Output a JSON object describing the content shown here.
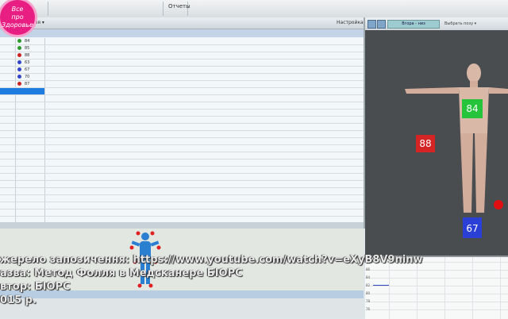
{
  "toolbar": {
    "tab_label": "Отчеты"
  },
  "left_panel": {
    "column_header": "ория ▾",
    "settings_label": "Настройка"
  },
  "rows": [
    {
      "value": "84",
      "color": "#2e9a2e"
    },
    {
      "value": "85",
      "color": "#2e9a2e"
    },
    {
      "value": "88",
      "color": "#cc2222"
    },
    {
      "value": "63",
      "color": "#3344cc"
    },
    {
      "value": "67",
      "color": "#3344cc"
    },
    {
      "value": "70",
      "color": "#3344cc"
    },
    {
      "value": "87",
      "color": "#cc2222"
    }
  ],
  "right_panel": {
    "view_button": "Вгора - низ",
    "select_label": "Выбрать позу ▾",
    "markers": [
      {
        "value": "84",
        "color": "#25c43a"
      },
      {
        "value": "88",
        "color": "#d42424"
      },
      {
        "value": "67",
        "color": "#2a3fd6"
      }
    ]
  },
  "graph_labels": [
    "88",
    "86",
    "84",
    "82",
    "80",
    "78",
    "76"
  ],
  "caption": {
    "line1": "жерело запозичення: https://www.youtube.com/watch?v=eXyB8V9ninw",
    "line2": "азва: Метод Фолля в Медсканере БІОРС",
    "line3": "втор: БІОРС",
    "line4": "015 р."
  },
  "logo": {
    "line1": "Все",
    "line2": "про",
    "line3": "Здоровье"
  }
}
